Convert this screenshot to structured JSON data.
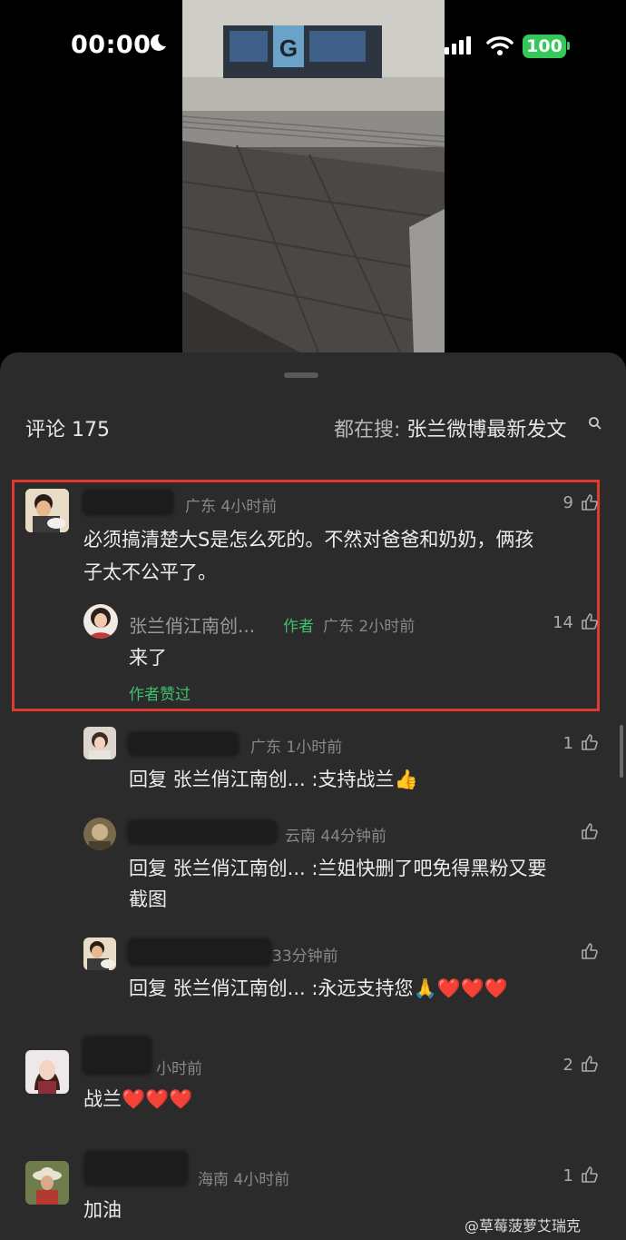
{
  "status_bar": {
    "time": "00:00",
    "battery": "100"
  },
  "header": {
    "comments_label": "评论 175",
    "search_prefix": "都在搜: ",
    "search_term": "张兰微博最新发文"
  },
  "comments": [
    {
      "user": "",
      "location": "广东 4小时前",
      "likes": "9",
      "text_line1": "必须搞清楚大S是怎么死的。不然对爸爸和奶奶，俩孩",
      "text_line2": "子太不公平了。"
    },
    {
      "user": "张兰俏江南创...",
      "author_tag": "作者",
      "location": "广东 2小时前",
      "likes": "14",
      "text": "来了",
      "author_liked": "作者赞过"
    },
    {
      "user": "",
      "location": "广东 1小时前",
      "likes": "1",
      "text": "回复 张兰俏江南创... :支持战兰👍"
    },
    {
      "user": "",
      "location": "云南 44分钟前",
      "likes": "",
      "text_line1": "回复 张兰俏江南创... :兰姐快删了吧免得黑粉又要",
      "text_line2": "截图"
    },
    {
      "user": "",
      "location": "33分钟前",
      "likes": "",
      "text": "回复 张兰俏江南创... :永远支持您🙏❤️❤️❤️"
    },
    {
      "user": "",
      "location": "小时前",
      "likes": "2",
      "text": "战兰❤️❤️❤️"
    },
    {
      "user": "",
      "location": "海南 4小时前",
      "likes": "1",
      "text": "加油"
    }
  ],
  "watermark": "@草莓菠萝艾瑞克",
  "colors": {
    "accent_green": "#3ec06b",
    "highlight_red": "#e23a30",
    "sheet_bg": "#2b2b2b"
  }
}
